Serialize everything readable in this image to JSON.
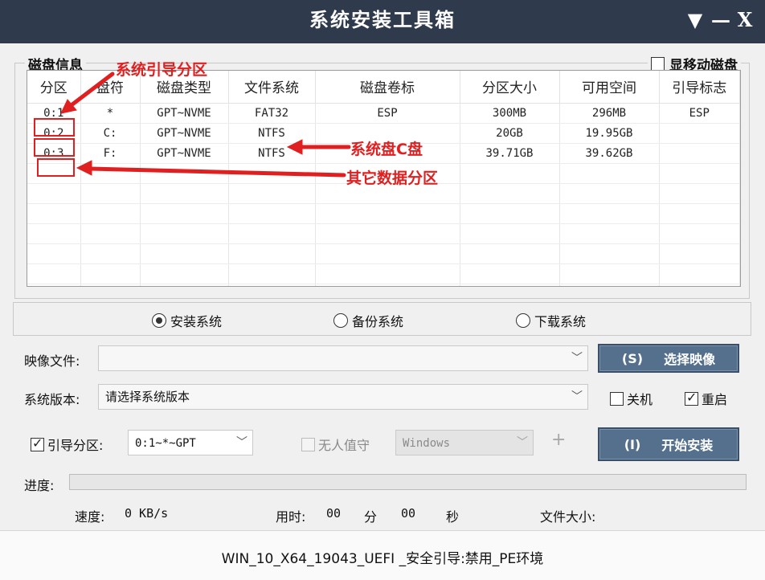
{
  "window": {
    "title": "系统安装工具箱",
    "menu_glyph": "▼",
    "minimize_glyph": "—",
    "close_glyph": "X"
  },
  "disk_info": {
    "group_title": "磁盘信息",
    "show_removable_label": "显移动磁盘",
    "show_removable_checked": false,
    "columns": [
      "分区",
      "盘符",
      "磁盘类型",
      "文件系统",
      "磁盘卷标",
      "分区大小",
      "可用空间",
      "引导标志"
    ],
    "rows": [
      [
        "0:1",
        "*",
        "GPT~NVME",
        "FAT32",
        "ESP",
        "300MB",
        "296MB",
        "ESP"
      ],
      [
        "0:2",
        "C:",
        "GPT~NVME",
        "NTFS",
        "",
        "20GB",
        "19.95GB",
        ""
      ],
      [
        "0:3",
        "F:",
        "GPT~NVME",
        "NTFS",
        "",
        "39.71GB",
        "39.62GB",
        ""
      ]
    ],
    "empty_rows": 7
  },
  "annotations": {
    "boot_partition": "系统引导分区",
    "system_disk": "系统盘C盘",
    "other_partitions": "其它数据分区",
    "color": "#e02020"
  },
  "modes": [
    {
      "label": "安装系统",
      "selected": true
    },
    {
      "label": "备份系统",
      "selected": false
    },
    {
      "label": "下载系统",
      "selected": false
    }
  ],
  "image_file": {
    "label": "映像文件:",
    "value": "",
    "button": {
      "hotkey": "(S)",
      "label": "选择映像"
    }
  },
  "version": {
    "label": "系统版本:",
    "value": "请选择系统版本"
  },
  "shutdown": {
    "label": "关机",
    "checked": false
  },
  "restart": {
    "label": "重启",
    "checked": true
  },
  "boot_partition": {
    "label": "引导分区:",
    "checked": true,
    "value": "0:1~*~GPT"
  },
  "unattended": {
    "label": "无人值守",
    "checked": false,
    "select_value": "Windows",
    "plus": "+"
  },
  "start_button": {
    "hotkey": "(I)",
    "label": "开始安装"
  },
  "progress": {
    "label": "进度:",
    "fraction": 0
  },
  "status": {
    "speed_label": "速度:",
    "speed_value": "0 KB/s",
    "time_label": "用时:",
    "minutes": "00",
    "min_unit": "分",
    "seconds": "00",
    "sec_unit": "秒",
    "size_label": "文件大小:"
  },
  "footer": "WIN_10_X64_19043_UEFI _安全引导:禁用_PE环境"
}
